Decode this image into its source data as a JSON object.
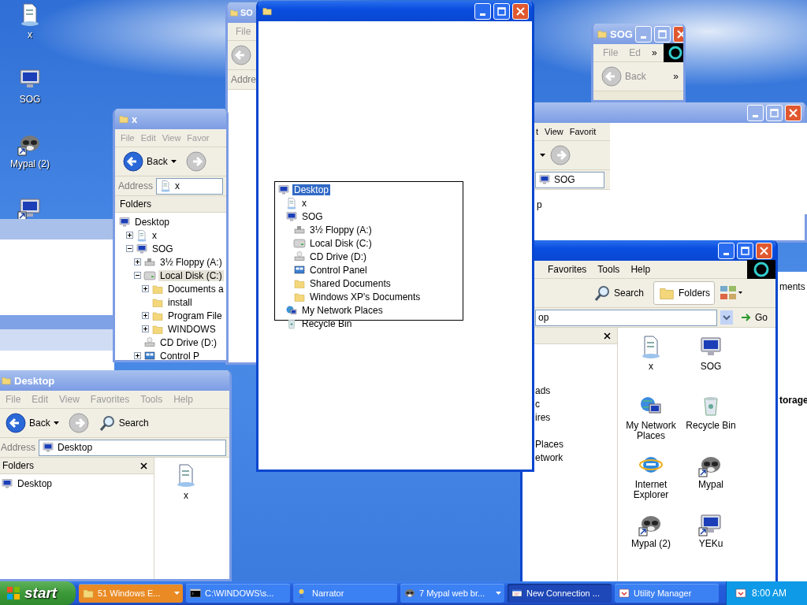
{
  "desktop_icons": [
    {
      "label": "x",
      "kind": "document",
      "shortcut": false
    },
    {
      "label": "SOG",
      "kind": "computer",
      "shortcut": false
    },
    {
      "label": "Mypal (2)",
      "kind": "raccoon",
      "shortcut": true
    },
    {
      "kind": "computer",
      "shortcut": true
    }
  ],
  "sog_window": {
    "title": "SOG",
    "active": false,
    "menu": [
      "File",
      "Ed"
    ],
    "menu_overflow": "»",
    "back": "Back",
    "toolbar_overflow": "»"
  },
  "so_window": {
    "title": "SO",
    "active": false,
    "menu": [
      "File"
    ],
    "address_label": "Addre"
  },
  "x_window": {
    "title": "x",
    "active": false,
    "menu": [
      "File",
      "Edit",
      "View",
      "Favor"
    ],
    "back": "Back",
    "address_label": "Address",
    "address": "x",
    "folders_title": "Folders",
    "tree": [
      {
        "label": "Desktop",
        "kind": "desktop",
        "selected": false,
        "children": [
          {
            "label": "x",
            "kind": "document",
            "expander": true,
            "expanded": false,
            "selected": false
          },
          {
            "label": "SOG",
            "kind": "computer",
            "expander": true,
            "expanded": true,
            "selected": false,
            "children": [
              {
                "label": "3½ Floppy (A:)",
                "kind": "floppy",
                "expander": true,
                "expanded": false,
                "selected": false
              },
              {
                "label": "Local Disk (C:)",
                "kind": "disk",
                "expander": true,
                "expanded": true,
                "selected": true,
                "children": [
                  {
                    "label": "Documents a",
                    "kind": "folder",
                    "expander": true,
                    "expanded": false,
                    "selected": false
                  },
                  {
                    "label": "install",
                    "kind": "folder",
                    "expander": false,
                    "selected": false
                  },
                  {
                    "label": "Program File",
                    "kind": "folder",
                    "expander": true,
                    "expanded": false,
                    "selected": false
                  },
                  {
                    "label": "WINDOWS",
                    "kind": "folder",
                    "expander": true,
                    "expanded": false,
                    "selected": false
                  }
                ]
              },
              {
                "label": "CD Drive (D:)",
                "kind": "cd",
                "expander": false,
                "selected": false
              },
              {
                "label": "Control P",
                "kind": "control",
                "expander": true,
                "expanded": false,
                "selected": false
              }
            ]
          }
        ]
      }
    ]
  },
  "back_window": {
    "active": false,
    "menu": [
      "t",
      "View",
      "Favorit"
    ],
    "address": "SOG",
    "pane_text": "p"
  },
  "main_window": {
    "active": true,
    "menu": [
      "Favorites",
      "Tools",
      "Help"
    ],
    "search": "Search",
    "folders": "Folders",
    "address": "op",
    "go": "Go",
    "pane_lines": [
      "ads",
      "c",
      "ires",
      "Places",
      "etwork"
    ],
    "icons": [
      {
        "label": "x",
        "kind": "document",
        "shortcut": false
      },
      {
        "label": "SOG",
        "kind": "computer",
        "shortcut": false
      },
      {
        "label": "My Network Places",
        "kind": "network",
        "shortcut": false
      },
      {
        "label": "Recycle Bin",
        "kind": "recycle",
        "shortcut": false
      },
      {
        "label": "Internet Explorer",
        "kind": "ie",
        "shortcut": false
      },
      {
        "label": "Mypal",
        "kind": "raccoon",
        "shortcut": true
      },
      {
        "label": "Mypal (2)",
        "kind": "raccoon",
        "shortcut": true
      },
      {
        "label": "YEKu",
        "kind": "computer",
        "shortcut": true
      }
    ]
  },
  "side_texts": [
    {
      "text": "ments",
      "strong": false
    },
    {
      "text": "torage",
      "strong": true
    }
  ],
  "desktop_window": {
    "title": "Desktop",
    "active": false,
    "menu": [
      "File",
      "Edit",
      "View",
      "Favorites",
      "Tools",
      "Help"
    ],
    "back": "Back",
    "search": "Search",
    "address_label": "Address",
    "address": "Desktop",
    "folders_title": "Folders",
    "tree": [
      {
        "label": "Desktop",
        "kind": "desktop"
      }
    ],
    "files": [
      {
        "label": "x",
        "kind": "document"
      }
    ]
  },
  "front_window": {
    "active": true,
    "popup_tree": [
      {
        "label": "Desktop",
        "kind": "desktop",
        "selected": true,
        "children": [
          {
            "label": "x",
            "kind": "document",
            "selected": false
          },
          {
            "label": "SOG",
            "kind": "computer",
            "selected": false,
            "children": [
              {
                "label": "3½ Floppy (A:)",
                "kind": "floppy",
                "selected": false
              },
              {
                "label": "Local Disk (C:)",
                "kind": "disk",
                "selected": false
              },
              {
                "label": "CD Drive (D:)",
                "kind": "cd",
                "selected": false
              },
              {
                "label": "Control Panel",
                "kind": "control",
                "selected": false
              },
              {
                "label": "Shared Documents",
                "kind": "folder",
                "selected": false
              },
              {
                "label": "Windows XP's Documents",
                "kind": "folder",
                "selected": false
              }
            ]
          },
          {
            "label": "My Network Places",
            "kind": "network",
            "selected": false
          },
          {
            "label": "Recycle Bin",
            "kind": "recycle",
            "selected": false
          }
        ]
      }
    ]
  },
  "taskbar": {
    "start": "start",
    "clock": "8:00 AM",
    "tasks": [
      {
        "label": "51 Windows E...",
        "kind": "folder",
        "selected": false,
        "flashing": true,
        "grouped": true
      },
      {
        "label": "C:\\WINDOWS\\s...",
        "kind": "console",
        "selected": false,
        "flashing": false,
        "grouped": false
      },
      {
        "label": "Narrator",
        "kind": "narrator",
        "selected": false,
        "flashing": false,
        "grouped": false
      },
      {
        "label": "7 Mypal web br...",
        "kind": "raccoon",
        "selected": false,
        "flashing": false,
        "grouped": true
      },
      {
        "label": "New Connection ...",
        "kind": "connection",
        "selected": true,
        "flashing": false,
        "grouped": false
      },
      {
        "label": "Utility Manager",
        "kind": "utility",
        "selected": false,
        "flashing": false,
        "grouped": false
      }
    ]
  }
}
